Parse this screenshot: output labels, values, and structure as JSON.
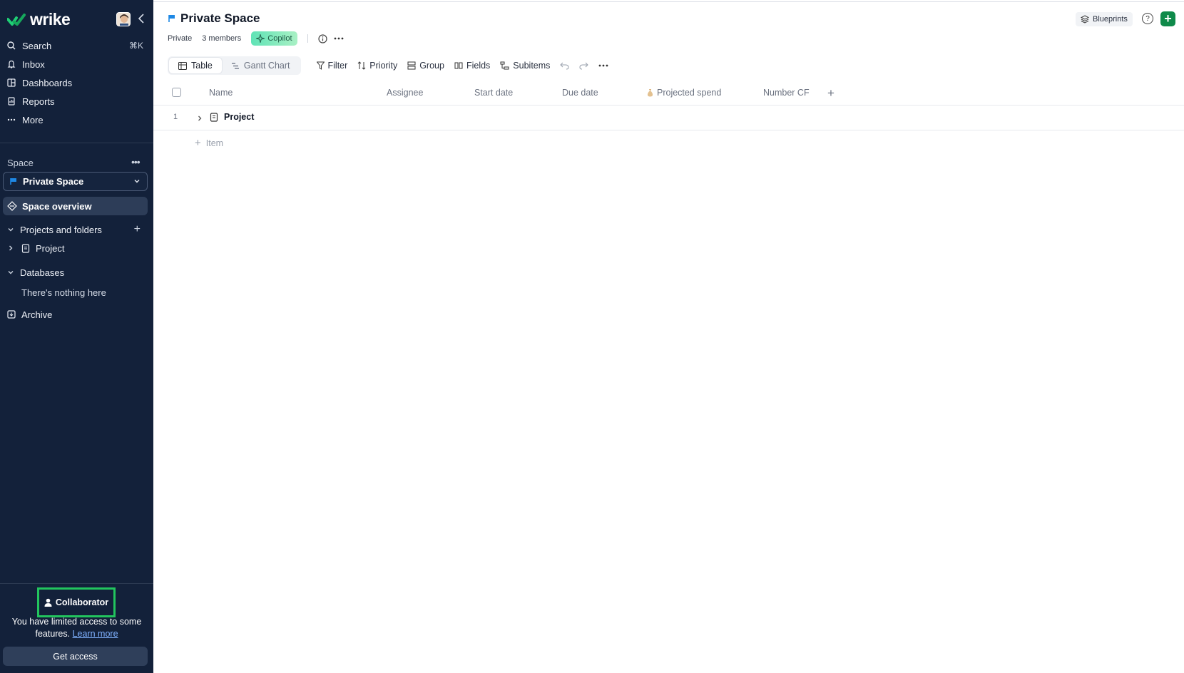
{
  "app": {
    "logo": "wrike"
  },
  "sidebar": {
    "nav": [
      {
        "label": "Search",
        "icon": "search-icon",
        "shortcut": "⌘K"
      },
      {
        "label": "Inbox",
        "icon": "bell-icon"
      },
      {
        "label": "Dashboards",
        "icon": "dashboard-icon"
      },
      {
        "label": "Reports",
        "icon": "report-icon"
      },
      {
        "label": "More",
        "icon": "more-dots-icon"
      }
    ],
    "space_label": "Space",
    "space_selected": "Private Space",
    "space_overview": "Space overview",
    "projects_folders": "Projects and folders",
    "project_item": "Project",
    "databases": "Databases",
    "databases_empty": "There's nothing here",
    "archive": "Archive",
    "role": "Collaborator",
    "limited_text": "You have limited access to some features.",
    "learn_more": "Learn more",
    "get_access": "Get access"
  },
  "header": {
    "title": "Private Space",
    "privacy": "Private",
    "members": "3 members",
    "copilot": "Copilot",
    "blueprints": "Blueprints",
    "help": "?",
    "add": "+"
  },
  "toolbar": {
    "views": [
      "Table",
      "Gantt Chart"
    ],
    "active_view": "Table",
    "tools": [
      "Filter",
      "Priority",
      "Group",
      "Fields",
      "Subitems"
    ]
  },
  "table": {
    "columns": [
      "Name",
      "Assignee",
      "Start date",
      "Due date",
      "Projected spend",
      "Number CF"
    ],
    "rows": [
      {
        "num": "1",
        "name": "Project"
      }
    ],
    "add_item": "Item"
  },
  "colors": {
    "sidebar_bg": "#13213a",
    "accent_green": "#0f8a4a",
    "highlight": "#22c55e",
    "flag_blue": "#1e88e5"
  }
}
